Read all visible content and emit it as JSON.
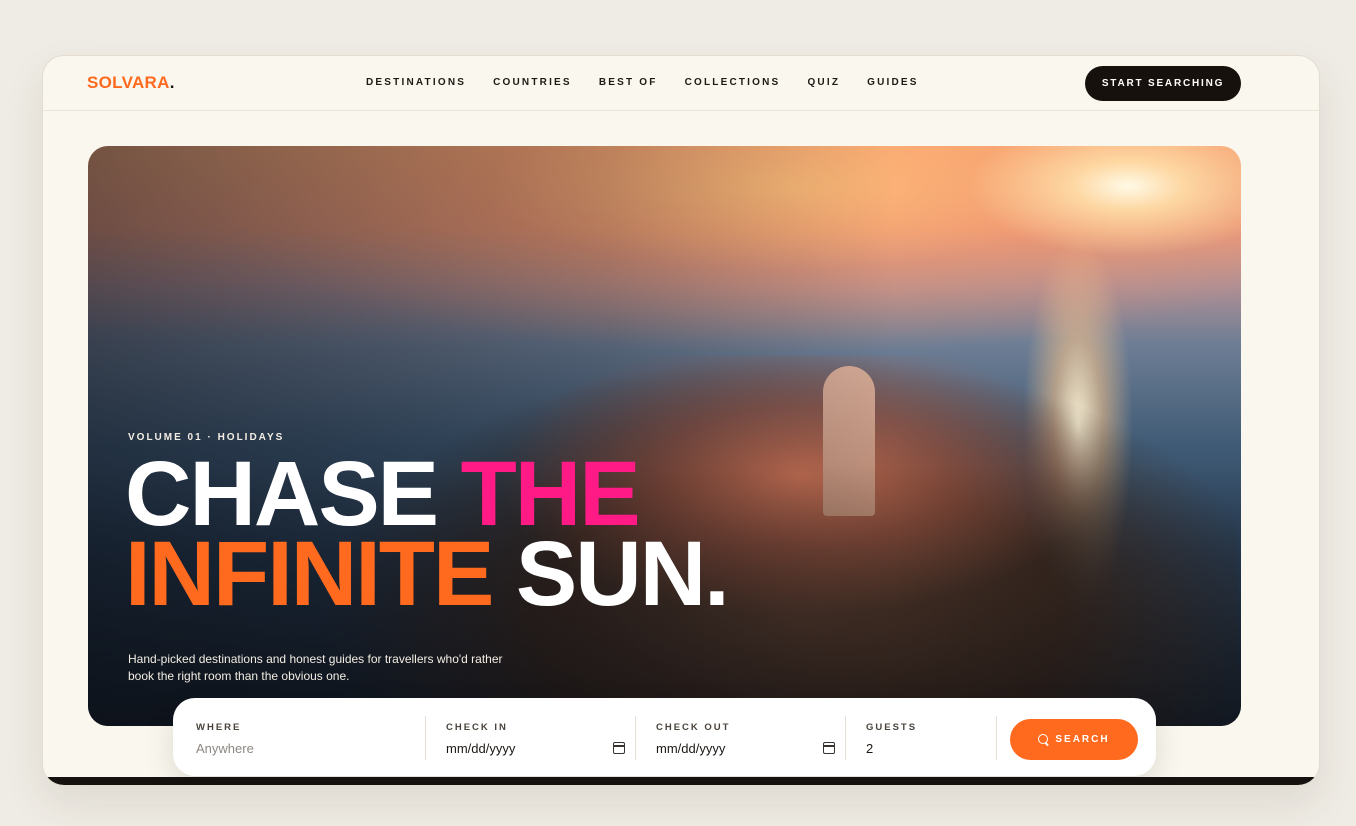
{
  "brand": {
    "name": "SOLVARA",
    "dot": ".",
    "accent": "#ff6a1f"
  },
  "nav": {
    "items": [
      "DESTINATIONS",
      "COUNTRIES",
      "BEST OF",
      "COLLECTIONS",
      "QUIZ",
      "GUIDES"
    ],
    "cta_label": "START SEARCHING"
  },
  "hero": {
    "kicker": "VOLUME 01 · HOLIDAYS",
    "headline": {
      "line1_a": "CHASE ",
      "line1_b": "THE",
      "line2_a": "INFINITE ",
      "line2_b": "SUN."
    },
    "subcopy": "Hand-picked destinations and honest guides for travellers who'd rather book the right room than the obvious one.",
    "colors": {
      "pink": "#ff1a86",
      "orange": "#ff6a1f",
      "white": "#ffffff"
    }
  },
  "search": {
    "where_label": "WHERE",
    "where_placeholder": "Anywhere",
    "checkin_label": "CHECK IN",
    "checkin_value": "mm/dd/yyyy",
    "checkout_label": "CHECK OUT",
    "checkout_value": "mm/dd/yyyy",
    "guests_label": "GUESTS",
    "guests_value": "2",
    "button_label": "SEARCH",
    "button_icon": "search-icon"
  }
}
